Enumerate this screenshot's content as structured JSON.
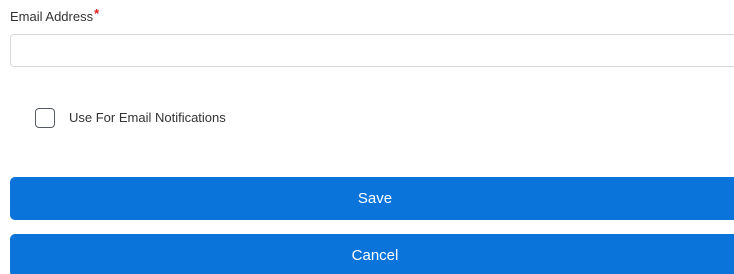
{
  "form": {
    "email_label": "Email Address",
    "required_marker": "*",
    "email_value": "",
    "email_placeholder": "",
    "notifications_label": "Use For Email Notifications",
    "notifications_checked": false
  },
  "actions": {
    "save_label": "Save",
    "cancel_label": "Cancel"
  },
  "colors": {
    "primary_button": "#0a74da",
    "required_star": "#e02020"
  }
}
